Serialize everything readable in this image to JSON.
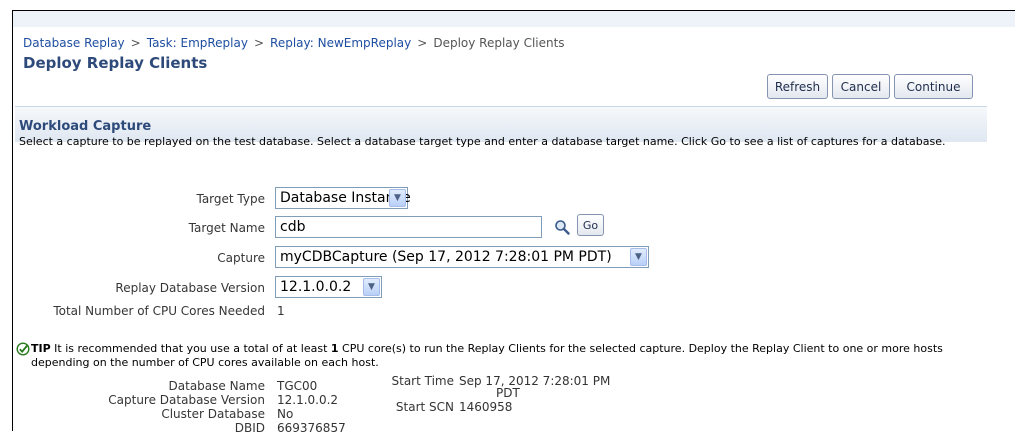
{
  "breadcrumb": {
    "items": [
      "Database Replay",
      "Task: EmpReplay",
      "Replay: NewEmpReplay"
    ],
    "separator": ">",
    "current": "Deploy Replay Clients"
  },
  "page_title": "Deploy Replay Clients",
  "buttons": {
    "refresh": "Refresh",
    "cancel": "Cancel",
    "continue": "Continue",
    "go": "Go"
  },
  "workload_capture": {
    "title": "Workload Capture",
    "description": "Select a capture to be replayed on the test database. Select a database target type and enter a database target name. Click Go to see a list of captures for a database."
  },
  "form": {
    "target_type": {
      "label": "Target Type",
      "value": "Database Instance"
    },
    "target_name": {
      "label": "Target Name",
      "value": "cdb"
    },
    "capture": {
      "label": "Capture",
      "value": "myCDBCapture (Sep 17, 2012 7:28:01 PM PDT)"
    },
    "replay_db_version": {
      "label": "Replay Database Version",
      "value": "12.1.0.0.2"
    },
    "cpu_cores": {
      "label": "Total Number of CPU Cores Needed",
      "value": "1"
    }
  },
  "tip": {
    "label": "TIP",
    "text_before": "It is recommended that you use a total of at least",
    "count": "1",
    "text_after": "CPU core(s) to run the Replay Clients for the selected capture. Deploy the Replay Client to one or more hosts depending on the number of CPU cores available on each host."
  },
  "details": {
    "database_name": {
      "label": "Database Name",
      "value": "TGC00"
    },
    "capture_db_version": {
      "label": "Capture Database Version",
      "value": "12.1.0.0.2"
    },
    "cluster_database": {
      "label": "Cluster Database",
      "value": "No"
    },
    "dbid": {
      "label": "DBID",
      "value": "669376857"
    },
    "start_time": {
      "label": "Start Time",
      "value_line1": "Sep 17, 2012 7:28:01 PM",
      "value_line2": "PDT"
    },
    "start_scn": {
      "label": "Start SCN",
      "value": "1460958"
    }
  },
  "icons": {
    "search": "search-icon",
    "tip": "check-circle-icon",
    "dropdown": "chevron-down-icon"
  },
  "colors": {
    "link": "#1f4ea1",
    "heading": "#2e4a7a",
    "tip_check": "#2a7a1f"
  }
}
